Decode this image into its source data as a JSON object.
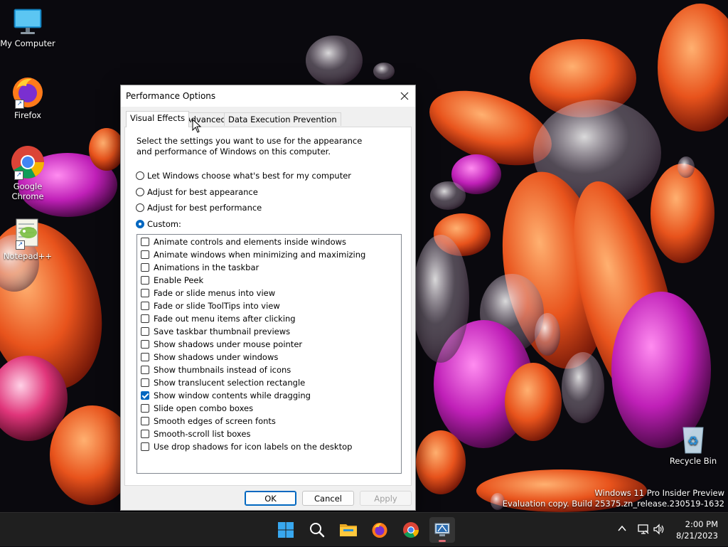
{
  "desktop": {
    "icons": [
      {
        "label": "My Computer",
        "icon": "monitor-icon"
      },
      {
        "label": "Firefox",
        "icon": "firefox-icon"
      },
      {
        "label": "Google Chrome",
        "icon": "chrome-icon"
      },
      {
        "label": "Notepad++",
        "icon": "notepadpp-icon"
      },
      {
        "label": "Recycle Bin",
        "icon": "recycle-bin-icon"
      }
    ],
    "watermark_line1": "Windows 11 Pro Insider Preview",
    "watermark_line2": "Evaluation copy. Build 25375.zn_release.230519-1632"
  },
  "dialog": {
    "title": "Performance Options",
    "close_icon": "close-icon",
    "tabs": [
      {
        "label": "Visual Effects",
        "active": true
      },
      {
        "label": "Advanced",
        "active": false
      },
      {
        "label": "Data Execution Prevention",
        "active": false
      }
    ],
    "description": "Select the settings you want to use for the appearance and performance of Windows on this computer.",
    "radios": [
      {
        "label": "Let Windows choose what's best for my computer",
        "checked": false
      },
      {
        "label": "Adjust for best appearance",
        "checked": false
      },
      {
        "label": "Adjust for best performance",
        "checked": false
      },
      {
        "label": "Custom:",
        "checked": true
      }
    ],
    "options": [
      {
        "label": "Animate controls and elements inside windows",
        "checked": false
      },
      {
        "label": "Animate windows when minimizing and maximizing",
        "checked": false
      },
      {
        "label": "Animations in the taskbar",
        "checked": false
      },
      {
        "label": "Enable Peek",
        "checked": false
      },
      {
        "label": "Fade or slide menus into view",
        "checked": false
      },
      {
        "label": "Fade or slide ToolTips into view",
        "checked": false
      },
      {
        "label": "Fade out menu items after clicking",
        "checked": false
      },
      {
        "label": "Save taskbar thumbnail previews",
        "checked": false
      },
      {
        "label": "Show shadows under mouse pointer",
        "checked": false
      },
      {
        "label": "Show shadows under windows",
        "checked": false
      },
      {
        "label": "Show thumbnails instead of icons",
        "checked": false
      },
      {
        "label": "Show translucent selection rectangle",
        "checked": false
      },
      {
        "label": "Show window contents while dragging",
        "checked": true
      },
      {
        "label": "Slide open combo boxes",
        "checked": false
      },
      {
        "label": "Smooth edges of screen fonts",
        "checked": false
      },
      {
        "label": "Smooth-scroll list boxes",
        "checked": false
      },
      {
        "label": "Use drop shadows for icon labels on the desktop",
        "checked": false
      }
    ],
    "buttons": {
      "ok": "OK",
      "cancel": "Cancel",
      "apply": "Apply"
    }
  },
  "taskbar": {
    "apps": [
      "windows-start-icon",
      "search-icon",
      "file-explorer-icon",
      "firefox-icon",
      "chrome-icon",
      "system-properties-icon"
    ],
    "active_app": "system-properties-icon",
    "tray_icons": [
      "chevron-up-icon",
      "network-icon",
      "volume-icon"
    ],
    "time": "2:00 PM",
    "date": "8/21/2023"
  }
}
